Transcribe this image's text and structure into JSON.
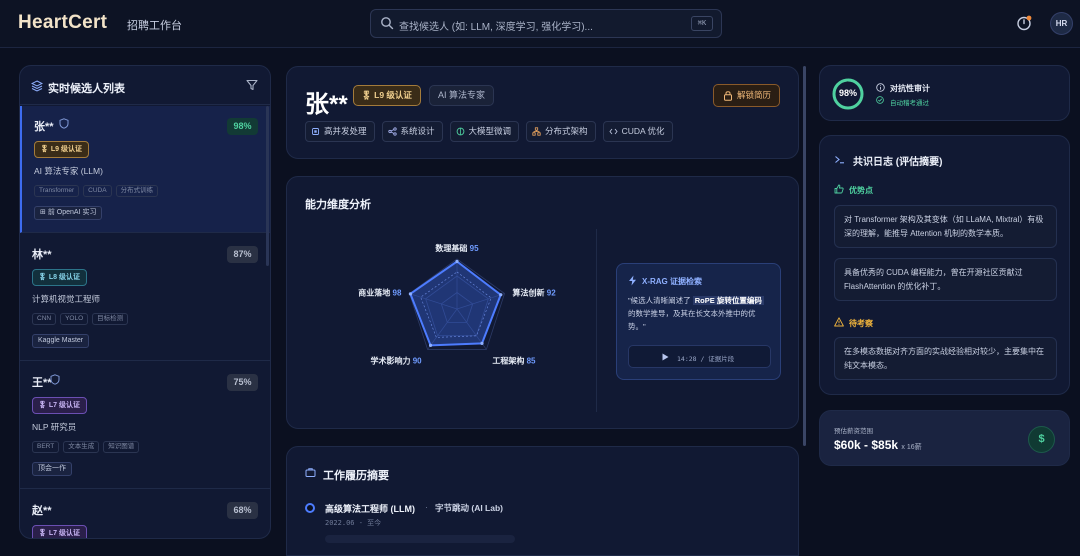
{
  "app": {
    "logo": "HeartCert",
    "subtitle": "招聘工作台",
    "search_placeholder": "查找候选人 (如: LLM, 深度学习, 强化学习)...",
    "search_shortcut": "⌘K",
    "avatar_initials": "HR"
  },
  "list": {
    "title": "实时候选人列表",
    "candidates": [
      {
        "name": "张**",
        "verified": true,
        "score": "98%",
        "level": "L9 级认证",
        "role": "AI 算法专家 (LLM)",
        "tags": [
          "Transformer",
          "CUDA",
          "分布式训练"
        ],
        "chip": "前 OpenAI 实习"
      },
      {
        "name": "林**",
        "verified": false,
        "score": "87%",
        "level": "L8 级认证",
        "role": "计算机视觉工程师",
        "tags": [
          "CNN",
          "YOLO",
          "目标检测"
        ],
        "chip": "Kaggle Master"
      },
      {
        "name": "王**",
        "verified": true,
        "score": "75%",
        "level": "L7 级认证",
        "role": "NLP 研究员",
        "tags": [
          "BERT",
          "文本生成",
          "知识图谱"
        ],
        "chip": "顶会一作"
      },
      {
        "name": "赵**",
        "verified": false,
        "score": "68%",
        "level": "L7 级认证",
        "role": "",
        "tags": [],
        "chip": ""
      }
    ]
  },
  "profile": {
    "name": "张**",
    "level": "L9 级认证",
    "role": "AI 算法专家",
    "unlock_label": "解锁简历",
    "skills": [
      "高并发处理",
      "系统设计",
      "大模型微调",
      "分布式架构",
      "CUDA 优化"
    ]
  },
  "ability": {
    "title": "能力维度分析",
    "radar": {
      "axes": [
        {
          "label": "数理基础",
          "value": 95
        },
        {
          "label": "算法创新",
          "value": 92
        },
        {
          "label": "工程架构",
          "value": 85
        },
        {
          "label": "学术影响力",
          "value": 90
        },
        {
          "label": "商业落地",
          "value": 98
        }
      ],
      "max": 100
    },
    "xrag": {
      "title": "X-RAG 证据检索",
      "text_before": "\"候选人清晰阐述了",
      "highlight": "RoPE 旋转位置编码",
      "text_after": "的数学推导，及其在长文本外推中的优势。\"",
      "clip_label": "14:28 / 证据片段"
    }
  },
  "work": {
    "title": "工作履历摘要",
    "job_title": "高级算法工程师 (LLM)",
    "separator": "·",
    "company": "字节跳动 (AI Lab)",
    "dates": "2022.06 - 至今"
  },
  "audit": {
    "score": "98%",
    "score_value": 0.98,
    "title": "对抗性审计",
    "status": "自动稽考通过"
  },
  "log": {
    "title": "共识日志 (评估摘要)",
    "strengths_label": "优势点",
    "strengths": [
      "对 Transformer 架构及其变体（如 LLaMA, Mixtral）有极深的理解，能推导 Attention 机制的数学本质。",
      "具备优秀的 CUDA 编程能力，曾在开源社区贡献过 FlashAttention 的优化补丁。"
    ],
    "concern_label": "待考察",
    "concerns": [
      "在多模态数据对齐方面的实战经验相对较少，主要集中在纯文本模态。"
    ]
  },
  "salary": {
    "label": "预估薪资范围",
    "value": "$60k - $85k",
    "unit": "x 16薪",
    "icon_symbol": "$"
  },
  "colors": {
    "accent_blue": "#3d6cf0",
    "success_green": "#4fd1a0",
    "gold": "#f0cf8e",
    "warning_amber": "#f0b43c"
  }
}
